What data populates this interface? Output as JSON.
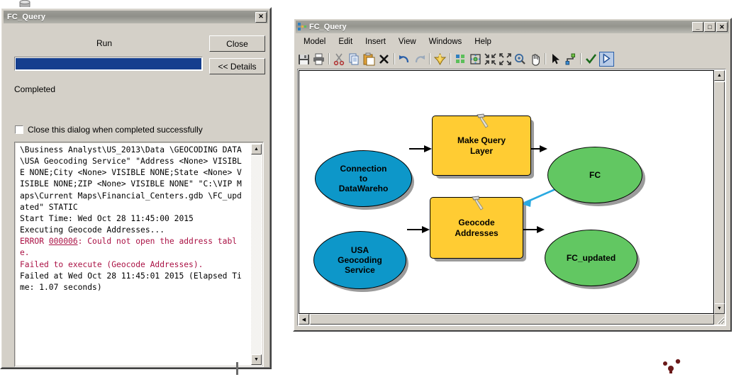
{
  "progress_dialog": {
    "title": "FC_Query",
    "close_icon": "close-x-icon",
    "run_label": "Run",
    "progress_percent": 100,
    "status_text": "Completed",
    "close_button_label": "Close",
    "details_button_label": "<< Details",
    "checkbox_label": "Close this dialog when completed successfully",
    "checkbox_checked": false,
    "log_lines": [
      {
        "text": "\\Business Analyst\\US_2013\\Data \\GEOCODING DATA\\USA Geocoding Service\" \"Address <None> VISIBLE NONE;City <None> VISIBLE NONE;State <None> VISIBLE NONE;ZIP <None> VISIBLE NONE\" \"C:\\VIP Maps\\Current Maps\\Financial_Centers.gdb \\FC_updated\" STATIC",
        "style": "normal"
      },
      {
        "text": "Start Time: Wed Oct 28 11:45:00 2015",
        "style": "normal"
      },
      {
        "text": "Executing Geocode Addresses...",
        "style": "normal"
      },
      {
        "text": "ERROR 000006: Could not open the address table.",
        "style": "error",
        "error_code": "000006"
      },
      {
        "text": "Failed to execute (Geocode Addresses).",
        "style": "error"
      },
      {
        "text": "Failed at Wed Oct 28 11:45:01 2015 (Elapsed Time: 1.07 seconds)",
        "style": "normal"
      }
    ],
    "scroll_up_icon": "scroll-up-arrow-icon",
    "scroll_down_icon": "scroll-down-arrow-icon"
  },
  "model_window": {
    "title": "FC_Query",
    "app_icon": "model-builder-icon",
    "window_buttons": [
      {
        "name": "minimize",
        "glyph": "_"
      },
      {
        "name": "maximize",
        "glyph": "□"
      },
      {
        "name": "close",
        "glyph": "✕"
      }
    ],
    "menu_items": [
      "Model",
      "Edit",
      "Insert",
      "View",
      "Windows",
      "Help"
    ],
    "toolbar_items": [
      {
        "name": "save-icon",
        "tip": "Save"
      },
      {
        "name": "print-icon",
        "tip": "Print"
      },
      {
        "name": "separator"
      },
      {
        "name": "cut-icon",
        "tip": "Cut"
      },
      {
        "name": "copy-icon",
        "tip": "Copy"
      },
      {
        "name": "paste-icon",
        "tip": "Paste"
      },
      {
        "name": "delete-icon",
        "tip": "Delete"
      },
      {
        "name": "separator"
      },
      {
        "name": "undo-icon",
        "tip": "Undo"
      },
      {
        "name": "redo-icon",
        "tip": "Redo"
      },
      {
        "name": "separator"
      },
      {
        "name": "add-data-icon",
        "tip": "Add Data or Tool"
      },
      {
        "name": "separator"
      },
      {
        "name": "auto-layout-icon",
        "tip": "Auto Layout"
      },
      {
        "name": "fit-to-window-icon",
        "tip": "Full Extent"
      },
      {
        "name": "zoom-out-page-icon",
        "tip": "Zoom Out"
      },
      {
        "name": "zoom-in-page-icon",
        "tip": "Zoom In"
      },
      {
        "name": "zoom-magnifier-icon",
        "tip": "Zoom In Tool"
      },
      {
        "name": "pan-hand-icon",
        "tip": "Pan"
      },
      {
        "name": "separator"
      },
      {
        "name": "select-pointer-icon",
        "tip": "Select"
      },
      {
        "name": "connect-icon",
        "tip": "Connect"
      },
      {
        "name": "separator"
      },
      {
        "name": "validate-check-icon",
        "tip": "Validate Entire Model"
      },
      {
        "name": "run-play-icon",
        "tip": "Run"
      }
    ],
    "scroll_left_icon": "scroll-left-arrow-icon",
    "scroll_up_icon": "scroll-up-arrow-icon",
    "scroll_down_icon": "scroll-down-arrow-icon",
    "diagram": {
      "colors": {
        "input_blue": "#0d97c9",
        "output_green": "#62c762",
        "tool_yellow": "#ffcc33",
        "shadow_gray": "#9b9b9b",
        "connector_black": "#000000",
        "connector_blue": "#29a9e1",
        "outline": "#000000"
      },
      "nodes": [
        {
          "id": "conn-datawarehouse",
          "label": "Connection\nto\nDataWareho",
          "shape": "ellipse",
          "role": "input",
          "color": "#0d97c9"
        },
        {
          "id": "make-query-layer",
          "label": "Make Query\nLayer",
          "shape": "rounded-rect",
          "role": "tool",
          "color": "#ffcc33",
          "has_tool_icon": true
        },
        {
          "id": "fc",
          "label": "FC",
          "shape": "ellipse",
          "role": "derived-output",
          "color": "#62c762"
        },
        {
          "id": "usa-geocoding-service",
          "label": "USA\nGeocoding\nService",
          "shape": "ellipse",
          "role": "input",
          "color": "#0d97c9"
        },
        {
          "id": "geocode-addresses",
          "label": "Geocode\nAddresses",
          "shape": "rounded-rect",
          "role": "tool",
          "color": "#ffcc33",
          "has_tool_icon": true
        },
        {
          "id": "fc-updated",
          "label": "FC_updated",
          "shape": "ellipse",
          "role": "derived-output",
          "color": "#62c762"
        }
      ],
      "connectors": [
        {
          "from": "conn-datawarehouse",
          "to": "make-query-layer",
          "color": "#000000"
        },
        {
          "from": "make-query-layer",
          "to": "fc",
          "color": "#000000"
        },
        {
          "from": "usa-geocoding-service",
          "to": "geocode-addresses",
          "color": "#000000"
        },
        {
          "from": "geocode-addresses",
          "to": "fc-updated",
          "color": "#000000"
        },
        {
          "from": "fc",
          "to": "geocode-addresses",
          "color": "#29a9e1"
        }
      ]
    }
  },
  "desktop": {
    "stray_cylinder_icon": "database-cylinder-icon",
    "bottom_dots_icon": "red-dots-marker-icon"
  }
}
